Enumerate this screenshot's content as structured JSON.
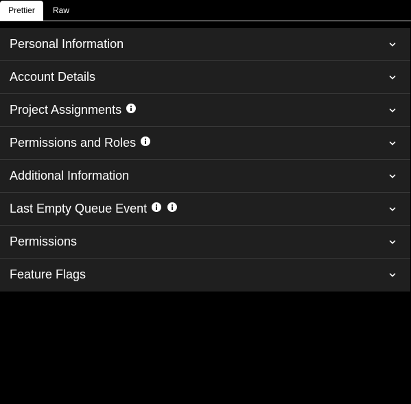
{
  "tabs": [
    {
      "label": "Prettier",
      "active": true
    },
    {
      "label": "Raw",
      "active": false
    }
  ],
  "sections": [
    {
      "title": "Personal Information",
      "info_icons": 0
    },
    {
      "title": "Account Details",
      "info_icons": 0
    },
    {
      "title": "Project Assignments",
      "info_icons": 1
    },
    {
      "title": "Permissions and Roles",
      "info_icons": 1
    },
    {
      "title": "Additional Information",
      "info_icons": 0
    },
    {
      "title": "Last Empty Queue Event",
      "info_icons": 2
    },
    {
      "title": "Permissions",
      "info_icons": 0
    },
    {
      "title": "Feature Flags",
      "info_icons": 0
    }
  ],
  "icons": {
    "info": "info-circle-icon",
    "expand": "chevron-down-icon"
  },
  "colors": {
    "background": "#000000",
    "section_bg": "#1f1f1f",
    "divider": "#383838",
    "active_tab_bg": "#ffffff",
    "text": "#ffffff"
  }
}
